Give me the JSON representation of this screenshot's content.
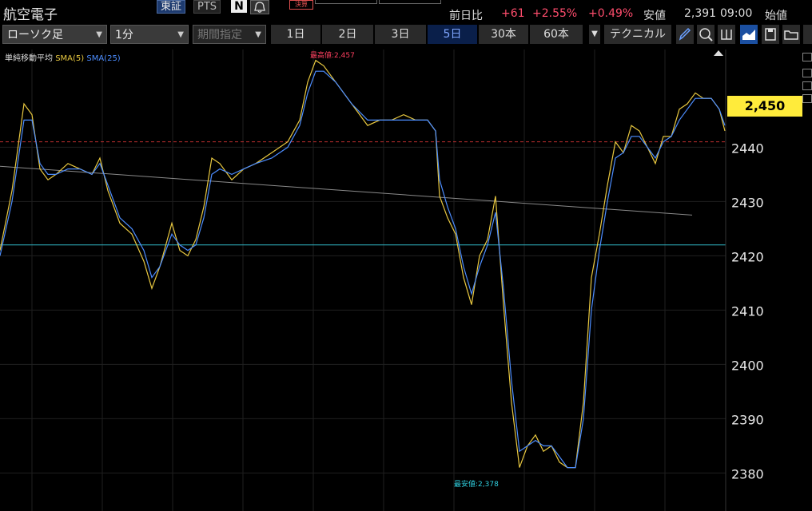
{
  "header": {
    "title": "航空電子",
    "market_tse": "東証",
    "market_pts": "PTS",
    "n_badge": "N",
    "kessan_badge": "決算",
    "quote": {
      "prev_label": "前日比",
      "change": "+61",
      "change_pct": "+2.55%",
      "extra_pct": "+0.49%",
      "low_label": "安値",
      "low_value": "2,391",
      "time": "09:00",
      "open_label": "始値"
    }
  },
  "toolbar": {
    "chart_type": "ローソク足",
    "interval": "1分",
    "period": "期間指定",
    "ranges": [
      "1日",
      "2日",
      "3日",
      "5日",
      "30本",
      "60本"
    ],
    "active_range": "5日",
    "technical": "テクニカル",
    "colors": {
      "tab_active_bg": "#0a1f4a",
      "tab_active_fg": "#7fa6ff"
    }
  },
  "legend": {
    "label": "単純移動平均",
    "sma5": "SMA(5)",
    "sma25": "SMA(25)"
  },
  "chart_data": {
    "type": "line",
    "title": "",
    "xlabel": "",
    "ylabel": "",
    "ylim": [
      2373,
      2458
    ],
    "y_ticks": [
      2440,
      2430,
      2420,
      2410,
      2400,
      2390,
      2380
    ],
    "grid": true,
    "current_price": "2,450",
    "high_label": "最高値:2,457",
    "low_label": "最安値:2,378",
    "prev_close": 2441,
    "hline": 2422,
    "trendline": [
      {
        "x": 0,
        "y": 2436.5
      },
      {
        "x": 866,
        "y": 2427.5
      }
    ],
    "series": [
      {
        "name": "SMA(5)",
        "color": "#e8c840",
        "x": [
          0,
          15,
          30,
          40,
          50,
          60,
          70,
          85,
          100,
          115,
          125,
          135,
          150,
          165,
          180,
          190,
          200,
          215,
          225,
          235,
          245,
          255,
          265,
          275,
          290,
          305,
          320,
          340,
          360,
          375,
          385,
          395,
          405,
          420,
          440,
          460,
          475,
          490,
          505,
          520,
          535,
          545,
          550,
          560,
          570,
          580,
          590,
          600,
          610,
          620,
          630,
          640,
          650,
          660,
          670,
          680,
          690,
          700,
          710,
          720,
          730,
          740,
          750,
          760,
          770,
          780,
          790,
          800,
          810,
          820,
          830,
          840,
          850,
          860,
          870,
          880,
          890,
          900,
          907
        ],
        "values": [
          2421,
          2432,
          2448,
          2446,
          2436,
          2434,
          2435,
          2437,
          2436,
          2435,
          2438,
          2432,
          2426,
          2424,
          2419,
          2414,
          2418,
          2426,
          2421,
          2420,
          2423,
          2429,
          2438,
          2437,
          2434,
          2436,
          2437,
          2439,
          2441,
          2445,
          2452,
          2456,
          2455,
          2452,
          2448,
          2444,
          2445,
          2445,
          2446,
          2445,
          2445,
          2443,
          2431,
          2427,
          2424,
          2416,
          2411,
          2420,
          2423,
          2431,
          2411,
          2393,
          2381,
          2385,
          2387,
          2384,
          2385,
          2382,
          2381,
          2381,
          2393,
          2416,
          2424,
          2433,
          2441,
          2439,
          2444,
          2443,
          2440,
          2437,
          2442,
          2442,
          2447,
          2448,
          2450,
          2449,
          2449,
          2447,
          2443
        ]
      },
      {
        "name": "SMA(25)",
        "color": "#4c8dff",
        "x": [
          0,
          15,
          30,
          40,
          50,
          60,
          70,
          85,
          100,
          115,
          125,
          135,
          150,
          165,
          180,
          190,
          200,
          215,
          225,
          235,
          245,
          255,
          265,
          275,
          290,
          305,
          320,
          340,
          360,
          375,
          385,
          395,
          405,
          420,
          440,
          460,
          475,
          490,
          505,
          520,
          535,
          545,
          550,
          560,
          570,
          580,
          590,
          600,
          610,
          620,
          630,
          640,
          650,
          660,
          670,
          680,
          690,
          700,
          710,
          720,
          730,
          740,
          750,
          760,
          770,
          780,
          790,
          800,
          810,
          820,
          830,
          840,
          850,
          860,
          870,
          880,
          890,
          900,
          907
        ],
        "values": [
          2420,
          2430,
          2445,
          2445,
          2437,
          2435,
          2435,
          2436,
          2436,
          2435,
          2437,
          2433,
          2427,
          2425,
          2421,
          2416,
          2418,
          2424,
          2422,
          2421,
          2422,
          2427,
          2435,
          2436,
          2435,
          2436,
          2437,
          2438,
          2440,
          2444,
          2450,
          2454,
          2454,
          2452,
          2448,
          2445,
          2445,
          2445,
          2445,
          2445,
          2445,
          2443,
          2434,
          2429,
          2425,
          2418,
          2413,
          2418,
          2422,
          2428,
          2414,
          2397,
          2384,
          2385,
          2386,
          2385,
          2385,
          2383,
          2381,
          2381,
          2390,
          2410,
          2421,
          2430,
          2438,
          2439,
          2442,
          2442,
          2440,
          2438,
          2441,
          2442,
          2445,
          2447,
          2449,
          2449,
          2449,
          2447,
          2444
        ]
      }
    ]
  }
}
